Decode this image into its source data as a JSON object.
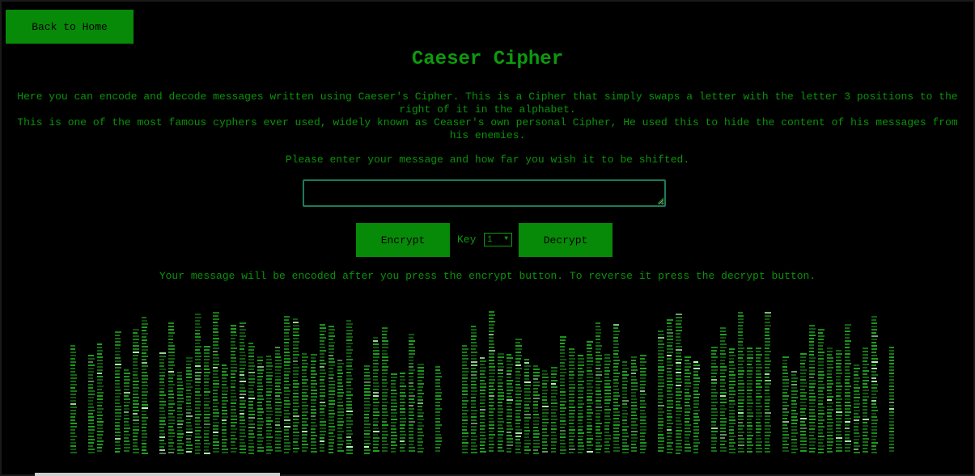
{
  "nav": {
    "back_label": "Back to Home"
  },
  "page": {
    "title": "Caeser Cipher",
    "intro_line1": "Here you can encode and decode messages written using Caeser's Cipher. This is a Cipher that simply swaps a letter with the letter 3 positions to the right of it in the alphabet.",
    "intro_line2": "This is one of the most famous cyphers ever used, widely known as Ceaser's own personal Cipher, He used this to hide the content of his messages from his enemies.",
    "prompt": "Please enter your message and how far you wish it to be shifted.",
    "hint": "Your message will be encoded after you press the encrypt button. To reverse it press the decrypt button."
  },
  "form": {
    "message_value": "",
    "encrypt_label": "Encrypt",
    "key_label": "Key",
    "key_value": "1",
    "decrypt_label": "Decrypt"
  },
  "colors": {
    "background": "#000000",
    "text": "#0a9a0a",
    "button": "#078a07",
    "input_border": "#1d7b5a",
    "matrix_glyph": "#1fa81f",
    "matrix_highlight": "#b8ffb8"
  },
  "icons": {
    "select": "chevron-down-icon",
    "resize": "resize-grip-icon"
  }
}
